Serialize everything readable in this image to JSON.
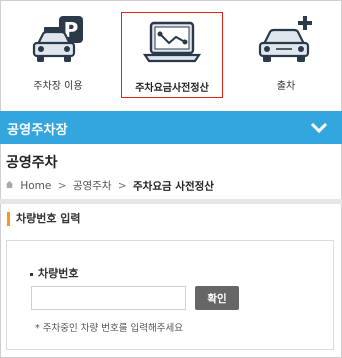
{
  "topmenu": {
    "items": [
      {
        "label": "주차장 이용",
        "icon": "parking-car-icon",
        "active": false
      },
      {
        "label": "주차요금사전정산",
        "icon": "laptop-payment-icon",
        "active": true
      },
      {
        "label": "출차",
        "icon": "car-exit-icon",
        "active": false
      }
    ],
    "parking_letter": "P"
  },
  "section_bar": {
    "label": "공영주차장",
    "icon": "chevron-down-icon"
  },
  "page": {
    "title": "공영주차"
  },
  "breadcrumb": {
    "home": "Home",
    "level1": "공영주차",
    "current": "주차요금 사전정산",
    "separator": ">"
  },
  "form": {
    "section_title": "차량번호 입력",
    "field_label": "차량번호",
    "input_value": "",
    "input_placeholder": "",
    "confirm_label": "확인",
    "note": "* 주차중인 차량 번호를 입력해주세요"
  },
  "colors": {
    "accent_blue": "#33a7dd",
    "active_border": "#e0251b",
    "section_marker": "#f39c12",
    "button_gray": "#666666"
  }
}
